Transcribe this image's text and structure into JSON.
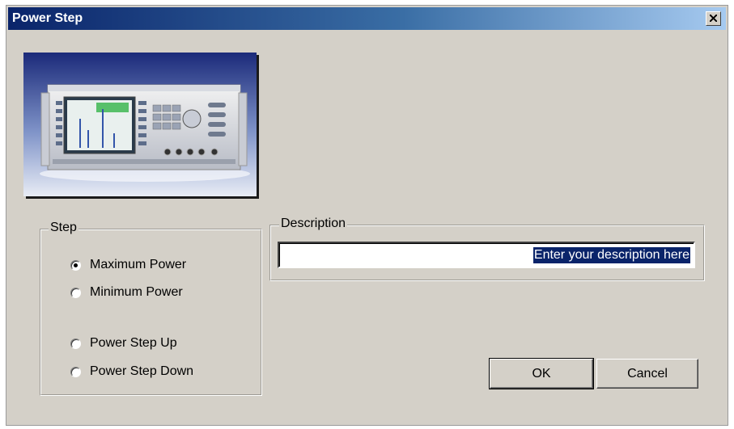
{
  "window": {
    "title": "Power Step",
    "close_label": "×"
  },
  "step_group": {
    "title": "Step",
    "options": [
      {
        "label": "Maximum Power",
        "checked": true
      },
      {
        "label": "Minimum Power",
        "checked": false
      },
      {
        "label": "Power Step Up",
        "checked": false
      },
      {
        "label": "Power Step Down",
        "checked": false
      }
    ]
  },
  "description_group": {
    "title": "Description",
    "value": "Enter your description here"
  },
  "buttons": {
    "ok": "OK",
    "cancel": "Cancel"
  },
  "colors": {
    "dialog_bg": "#d4d0c8",
    "titlebar_start": "#0a246a",
    "titlebar_end": "#a6caf0",
    "selection": "#0a246a"
  }
}
